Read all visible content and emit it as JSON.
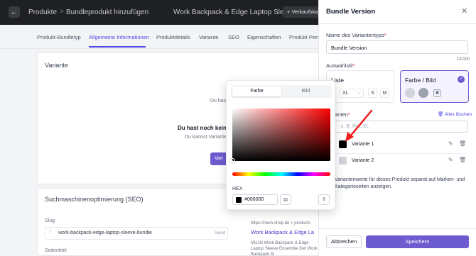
{
  "header": {
    "back_icon": "arrow-left-icon",
    "breadcrumb_root": "Produkte",
    "breadcrumb_sep": ">",
    "breadcrumb_current": "Bundleprodukt hinzufügen",
    "product_name": "Work Backpack & Edge Laptop Sle",
    "sale_button": "+ Verkaufskanal"
  },
  "tabs": [
    "Produkt-Bundletyp",
    "Allgemeine Informationen",
    "Produktdetails",
    "Variante",
    "SEO",
    "Eigenschaften",
    "Produkt Personal"
  ],
  "variant_card": {
    "title": "Variante",
    "cut_text": "Du hast noch keine",
    "empty_title": "Du hast noch keine",
    "empty_desc": "Du kannst Varianten",
    "button_cut": "Vari"
  },
  "seo_card": {
    "title": "Suchmaschinenoptimierung (SEO)",
    "slug_label": "Slug",
    "slug_prefix": "/",
    "slug_value": "work-backpack-edge-laptop-sleeve-bundle",
    "slug_action": "Seed",
    "second_label": "Seitentitel",
    "preview_url": "https://mein-shop.de > products",
    "preview_title": "Work Backpack & Edge La",
    "preview_desc": "MUJO Work Backpack & Edge Laptop Sleeve Ensemble Der Work Backpack fü"
  },
  "picker": {
    "tab_color": "Farbe",
    "tab_image": "Bild",
    "hex_label": "HEX",
    "hex_value": "#000000",
    "copy_icon": "copy-icon",
    "format_icon": "chevron-updown-icon"
  },
  "drawer": {
    "title": "Bundle Version",
    "close_icon": "close-icon",
    "type_label": "Name des Variantentyps",
    "type_value": "Bundle Version",
    "counter": "14/100",
    "choice_label": "Auswahlstil",
    "option_list": {
      "title": "Liste",
      "size_select": "XL",
      "size_s": "S",
      "size_m": "M"
    },
    "option_color": {
      "title": "Farbe / Bild",
      "selected": true
    },
    "variants_label": "anten",
    "delete_all": "Alles löschen",
    "variant_placeholder": "z. B. Rot, XL",
    "variants": [
      {
        "name": "Variante 1",
        "color": "#000000"
      },
      {
        "name": "Variante 2",
        "color": "#d1d5db"
      }
    ],
    "hint": "Variantenwerte für dieses Produkt separat auf Marken- und Kategorieseiten anzeigen.",
    "cancel": "Abbrechen",
    "save": "Speichern"
  },
  "colors": {
    "accent": "#6d5bd0",
    "link": "#4f46e5",
    "arrow": "#ef1c1c"
  }
}
